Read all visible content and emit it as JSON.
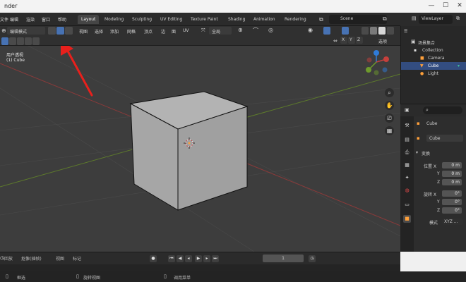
{
  "window": {
    "title": "nder"
  },
  "menubar": {
    "items": [
      "文件",
      "编辑",
      "渲染",
      "窗口",
      "帮助"
    ]
  },
  "workspaces": [
    "Layout",
    "Modeling",
    "Sculpting",
    "UV Editing",
    "Texture Paint",
    "Shading",
    "Animation",
    "Rendering"
  ],
  "scene": {
    "name": "Scene",
    "view_layer": "ViewLayer"
  },
  "viewport_header": {
    "mode": "编辑模式",
    "menus": [
      "视图",
      "选择",
      "添加",
      "网格",
      "顶点",
      "边",
      "面",
      "UV"
    ],
    "transform": "全局"
  },
  "viewport_header2": {
    "axes": [
      "X",
      "Y",
      "Z"
    ],
    "options": "选项"
  },
  "viewport": {
    "view_name": "用户透视",
    "object_label": "(1) Cube"
  },
  "outliner": {
    "title": "场景集合",
    "items": [
      {
        "label": "Collection",
        "icon": "collection-icon"
      },
      {
        "label": "Cube",
        "icon": "mesh-icon"
      },
      {
        "label": "Camera",
        "icon": "camera-icon"
      },
      {
        "label": "Light",
        "icon": "light-icon"
      }
    ]
  },
  "properties": {
    "object_name": "Cube",
    "data_name": "Cube",
    "section": "变换",
    "location_label": "位置 X",
    "rotation_label": "旋转 X",
    "mode_label": "模式",
    "axis_y": "Y",
    "axis_z": "Z",
    "location_values": [
      "0 m",
      "0 m",
      "0 m"
    ],
    "rotation_values": [
      "0°",
      "0°",
      "0°"
    ],
    "rotation_mode": "XYZ ..."
  },
  "timeline": {
    "playback": "回放",
    "keying": "抠像(插帧)",
    "view": "视图",
    "marker": "标记",
    "frame": "1"
  },
  "statusbar": {
    "select": "框选",
    "rotate": "旋转视图",
    "menu": "调用菜单"
  },
  "colors": {
    "accent": "#4772b3",
    "selection": "#ffa03a",
    "annotation_arrow": "#e8201c"
  }
}
